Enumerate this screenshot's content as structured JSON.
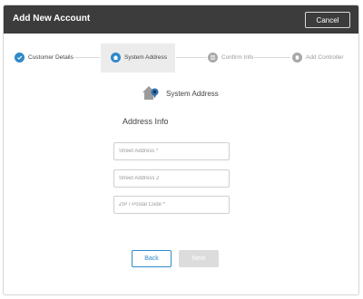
{
  "dialog": {
    "title": "Add New Account",
    "cancel_label": "Cancel"
  },
  "steps": [
    {
      "label": "Customer Details",
      "state": "complete",
      "icon": "check-icon"
    },
    {
      "label": "System Address",
      "state": "active",
      "icon": "home-icon"
    },
    {
      "label": "Confirm Info",
      "state": "pending",
      "icon": "document-icon"
    },
    {
      "label": "Add Controller",
      "state": "pending",
      "icon": "controller-icon"
    }
  ],
  "section": {
    "title": "System Address",
    "icon": "house-location-icon",
    "subtitle": "Address Info"
  },
  "form": {
    "street_placeholder": "Street Address *",
    "street2_placeholder": "Street Address 2",
    "zip_placeholder": "ZIP / Postal Code *"
  },
  "buttons": {
    "back_label": "Back",
    "next_label": "Next"
  },
  "colors": {
    "header_bg": "#3c3c3c",
    "accent": "#2f89c9",
    "pending": "#a8a8a8"
  }
}
